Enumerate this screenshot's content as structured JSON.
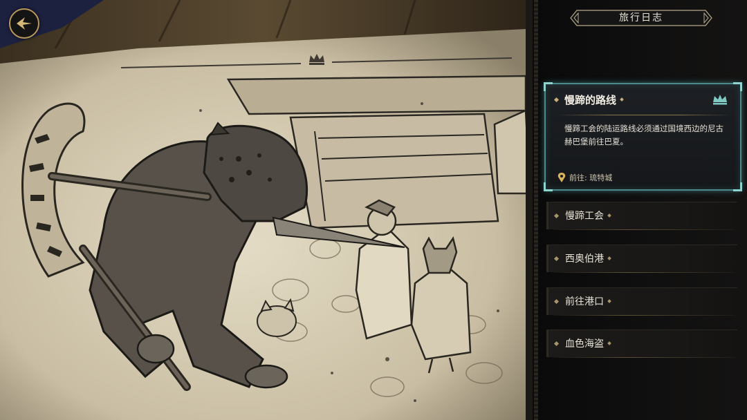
{
  "journal": {
    "title": "旅行日志",
    "active_quest": {
      "title": "慢蹄的路线",
      "description": "慢蹄工会的陆运路线必须通过国境西边的尼古赫巴堡前往巴夏。",
      "destination_label": "前往: 琉特城"
    },
    "quests": [
      {
        "label": "慢蹄工会"
      },
      {
        "label": "西奥伯港"
      },
      {
        "label": "前往港口"
      },
      {
        "label": "血色海盗"
      }
    ]
  },
  "icons": {
    "back": "back-arrow-icon",
    "crown": "crown-icon",
    "destination": "map-pin-icon"
  },
  "colors": {
    "accent_teal": "#4a8a8a",
    "gold": "#c9b07a",
    "panel_bg": "#111010",
    "parchment": "#d9cfb8"
  }
}
